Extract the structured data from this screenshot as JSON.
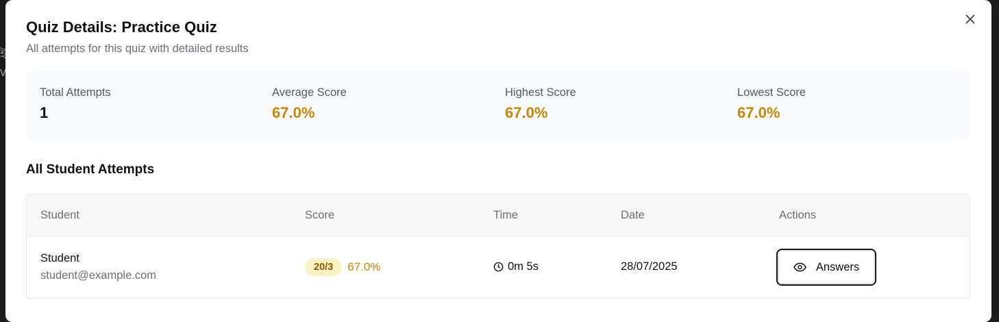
{
  "background": {
    "fragment_text": "ই\nv"
  },
  "modal": {
    "title": "Quiz Details: Practice Quiz",
    "subtitle": "All attempts for this quiz with detailed results",
    "close_icon": "close-icon"
  },
  "stats": [
    {
      "label": "Total Attempts",
      "value": "1",
      "color": "#0f1115"
    },
    {
      "label": "Average Score",
      "value": "67.0%",
      "color": "#c9870a"
    },
    {
      "label": "Highest Score",
      "value": "67.0%",
      "color": "#c9870a"
    },
    {
      "label": "Lowest Score",
      "value": "67.0%",
      "color": "#c9870a"
    }
  ],
  "attempts_section": {
    "title": "All Student Attempts",
    "columns": [
      "Student",
      "Score",
      "Time",
      "Date",
      "Actions"
    ],
    "rows": [
      {
        "student_name": "Student",
        "student_email": "student@example.com",
        "score_badge": "20/3",
        "score_percent": "67.0%",
        "time": "0m 5s",
        "time_icon": "clock-icon",
        "date": "28/07/2025",
        "action_label": "Answers",
        "action_icon": "eye-icon"
      }
    ]
  },
  "colors": {
    "accent_score": "#c9870a",
    "badge_bg": "#fbf2c4",
    "stats_bg": "#f8f9fa"
  }
}
